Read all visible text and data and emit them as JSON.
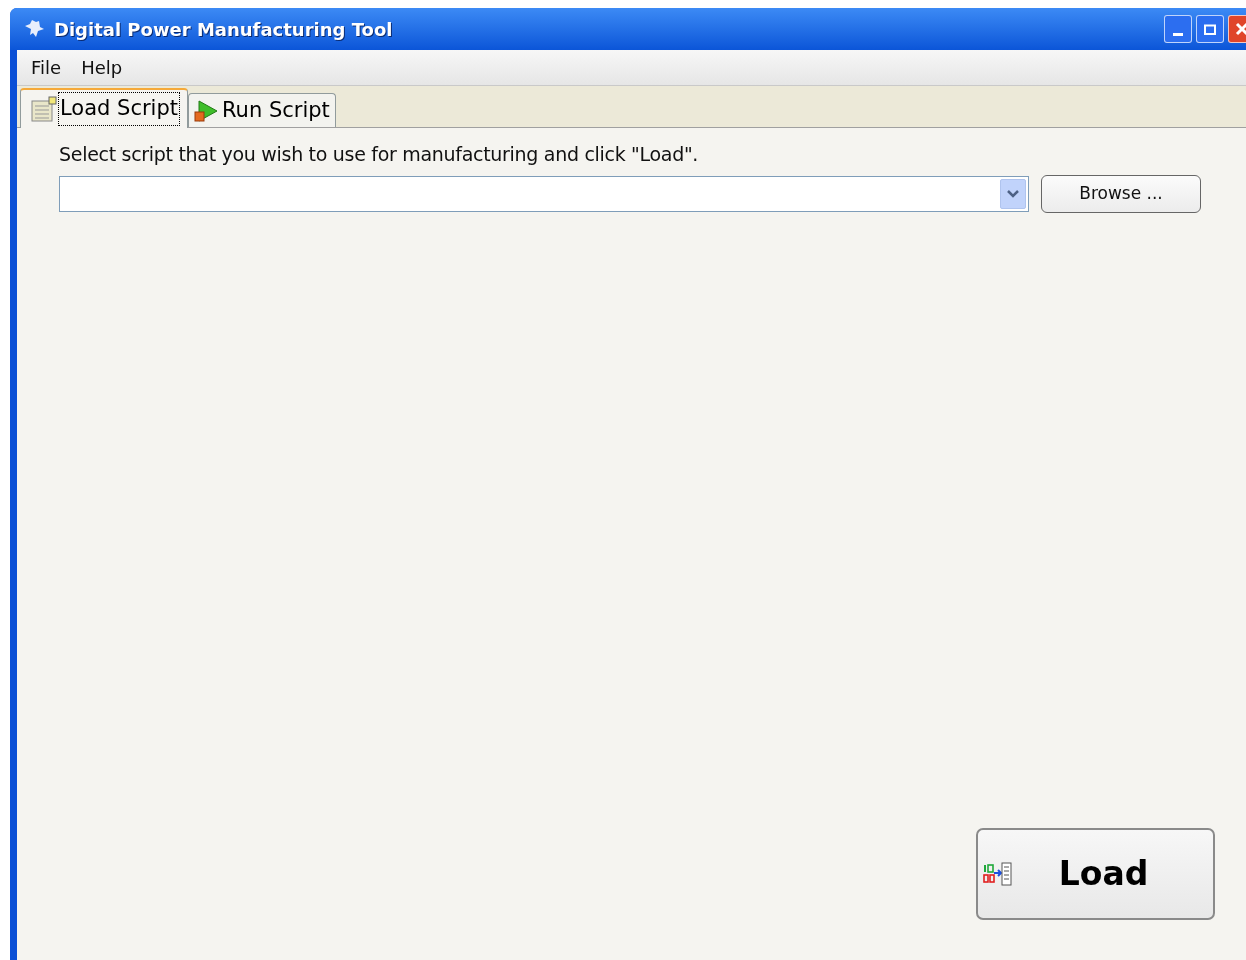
{
  "window": {
    "title": "Digital Power Manufacturing Tool"
  },
  "menu": [
    "File",
    "Help"
  ],
  "tabs": [
    {
      "label": "Load Script",
      "selected": true,
      "kind": "load"
    },
    {
      "label": "Run Script",
      "selected": false,
      "kind": "run"
    }
  ],
  "instruction": "Select script that you wish to use for manufacturing and click \"Load\".",
  "browse_button": "Browse ...",
  "load_button": "Load"
}
